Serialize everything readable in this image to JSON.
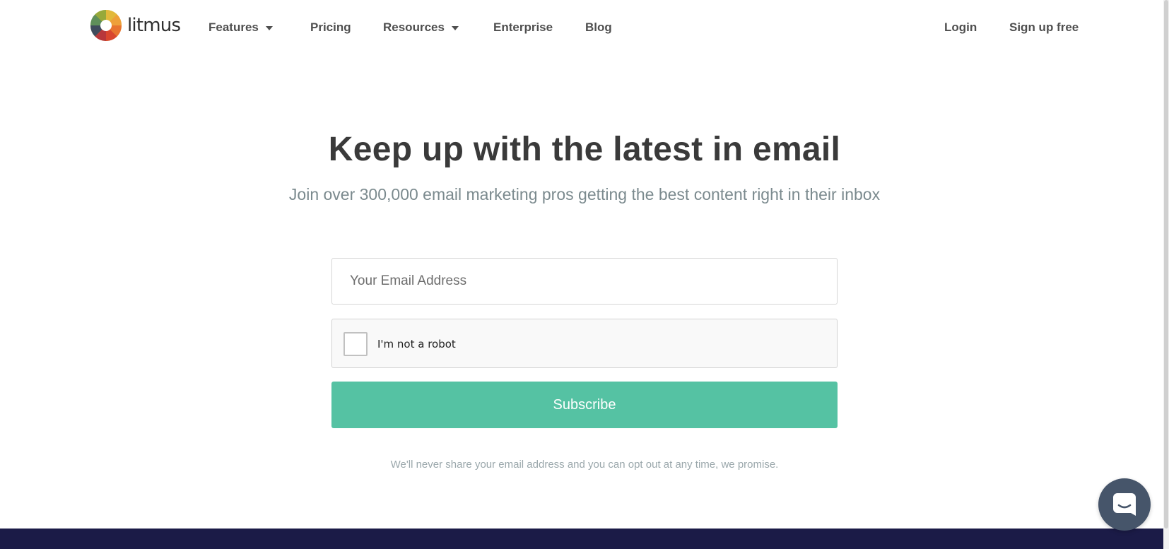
{
  "brand": {
    "name": "litmus"
  },
  "nav": {
    "left": [
      {
        "label": "Features",
        "has_dropdown": true
      },
      {
        "label": "Pricing",
        "has_dropdown": false
      },
      {
        "label": "Resources",
        "has_dropdown": true
      },
      {
        "label": "Enterprise",
        "has_dropdown": false
      },
      {
        "label": "Blog",
        "has_dropdown": false
      }
    ],
    "right": [
      {
        "label": "Login"
      },
      {
        "label": "Sign up free"
      }
    ]
  },
  "hero": {
    "title": "Keep up with the latest in email",
    "subtitle": "Join over 300,000 email marketing pros getting the best content right in their inbox"
  },
  "form": {
    "email_placeholder": "Your Email Address",
    "email_value": "",
    "captcha_label": "I'm not a robot",
    "captcha_checked": false,
    "subscribe_label": "Subscribe",
    "privacy_note": "We'll never share your email address and you can opt out at any time, we promise."
  },
  "icons": {
    "logo": "litmus-color-wheel-logo",
    "dropdown": "caret-down-icon",
    "chat": "chat-bubble-icon"
  },
  "colors": {
    "primary_button": "#55c2a3",
    "footer_band": "#1b1b47",
    "chat_launcher": "#46556a",
    "heading_text": "#3a3a3a",
    "subtitle_text": "#7b8a8e"
  }
}
